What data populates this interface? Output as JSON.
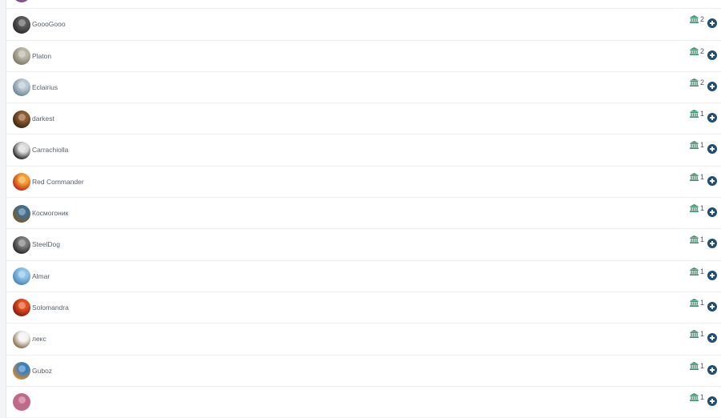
{
  "list": {
    "rows": [
      {
        "name": "",
        "count": "",
        "avatar_colors": [
          "#a06aa8",
          "#7a4c86"
        ]
      },
      {
        "name": "GoooGooo",
        "count": "2",
        "avatar_colors": [
          "#5a5a5a",
          "#2b2b2b"
        ]
      },
      {
        "name": "Platon",
        "count": "2",
        "avatar_colors": [
          "#b9b6a6",
          "#7d7a6a"
        ]
      },
      {
        "name": "Eclairius",
        "count": "2",
        "avatar_colors": [
          "#b9c9d2",
          "#6d8797"
        ]
      },
      {
        "name": "darkest",
        "count": "1",
        "avatar_colors": [
          "#8b5a2b",
          "#3b2412"
        ]
      },
      {
        "name": "Carrachiolla",
        "count": "1",
        "avatar_colors": [
          "#d9d9d9",
          "#222222"
        ]
      },
      {
        "name": "Red Commander",
        "count": "1",
        "avatar_colors": [
          "#f0a030",
          "#c0281c"
        ]
      },
      {
        "name": "Космогоник",
        "count": "1",
        "avatar_colors": [
          "#3f6f8f",
          "#7a5a2a"
        ]
      },
      {
        "name": "SteelDog",
        "count": "1",
        "avatar_colors": [
          "#7a7a7a",
          "#2a2a2a"
        ]
      },
      {
        "name": "Almar",
        "count": "1",
        "avatar_colors": [
          "#8ec3e6",
          "#4a86b8"
        ]
      },
      {
        "name": "Solomandra",
        "count": "1",
        "avatar_colors": [
          "#e0501e",
          "#8a1a10"
        ]
      },
      {
        "name": "лекс",
        "count": "1",
        "avatar_colors": [
          "#f2f2f2",
          "#8a6a4a"
        ]
      },
      {
        "name": "Guboz",
        "count": "1",
        "avatar_colors": [
          "#3a7fc0",
          "#d88a2a"
        ]
      },
      {
        "name": "",
        "count": "1",
        "avatar_colors": [
          "#c06a8a",
          "#c06a8a"
        ]
      }
    ]
  },
  "icons": {
    "count_icon": "institution-icon",
    "add_icon": "plus-circle-icon"
  },
  "colors": {
    "count_icon": "#3e8f6e",
    "add_button": "#1f4e79",
    "username_text": "#56606b"
  }
}
